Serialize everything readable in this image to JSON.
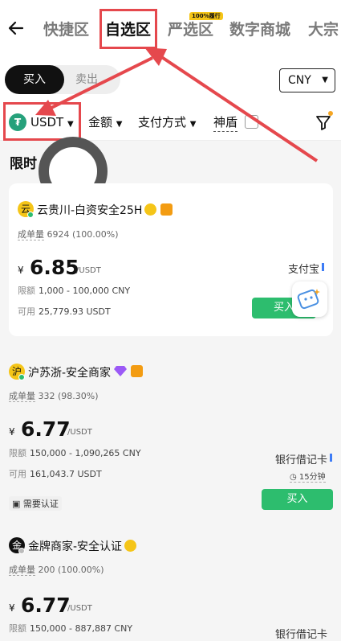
{
  "nav": {
    "back_icon": "arrow-left-icon",
    "tabs": [
      {
        "label": "快捷区"
      },
      {
        "label": "自选区"
      },
      {
        "label": "严选区"
      },
      {
        "label": "数字商城"
      },
      {
        "label": "大宗"
      }
    ],
    "badge": "100%履行"
  },
  "trade": {
    "buy_label": "买入",
    "sell_label": "卖出",
    "currency": "CNY"
  },
  "filters": {
    "coin": "USDT",
    "amount": "金额",
    "payment": "支付方式",
    "shield": "神盾"
  },
  "section_title": "限时",
  "ads": [
    {
      "merchant": "云贵川-白资安全25H",
      "avatar": "云",
      "volume_label": "成单量",
      "volume": "6924 (100.00%)",
      "currency_symbol": "¥",
      "price": "6.85",
      "unit": "/USDT",
      "limit_label": "限额",
      "limit": "1,000 - 100,000 CNY",
      "available_label": "可用",
      "available": "25,779.93 USDT",
      "payment": "支付宝",
      "buy_label": "买入"
    },
    {
      "merchant": "沪苏浙-安全商家",
      "avatar": "沪",
      "volume_label": "成单量",
      "volume": "332 (98.30%)",
      "currency_symbol": "¥",
      "price": "6.77",
      "unit": "/USDT",
      "limit_label": "限额",
      "limit": "150,000 - 1,090,265 CNY",
      "available_label": "可用",
      "available": "161,043.7 USDT",
      "payment": "银行借记卡",
      "time": "15分钟",
      "verify": "需要认证",
      "buy_label": "买入"
    },
    {
      "merchant": "金牌商家-安全认证",
      "avatar": "金",
      "volume_label": "成单量",
      "volume": "200 (100.00%)",
      "currency_symbol": "¥",
      "price": "6.77",
      "unit": "/USDT",
      "limit_label": "限额",
      "limit": "150,000 - 887,887 CNY",
      "payment": "银行借记卡"
    }
  ],
  "colors": {
    "accent_green": "#2dbd6e",
    "highlight_red": "#e5484d",
    "tether_green": "#26a17b"
  }
}
